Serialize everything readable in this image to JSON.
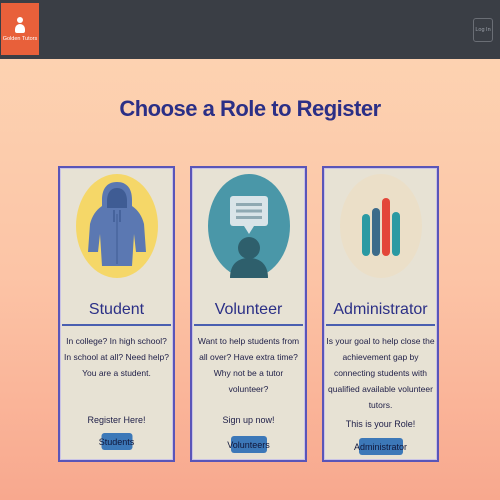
{
  "header": {
    "logo_text": "Golden Tutors",
    "login_label": "Log In"
  },
  "page_title": "Choose a Role to Register",
  "roles": [
    {
      "title": "Student",
      "description": "In college? In high school? In school at all? Need help? You are a student.",
      "cta_text": "Register Here!",
      "button_label": "Students",
      "avatar_icon": "hoodie-icon"
    },
    {
      "title": "Volunteer",
      "description": "Want to help students from all over? Have extra time? Why not be a tutor volunteer?",
      "cta_text": "Sign up now!",
      "button_label": "Volunteers",
      "avatar_icon": "person-speech-bubble-icon"
    },
    {
      "title": "Administrator",
      "description": "Is your goal to help close the achievement gap by connecting students with qualified available volunteer tutors.",
      "cta_text": "This is your Role!",
      "button_label": "Administrator",
      "avatar_icon": "bar-chart-icon"
    }
  ],
  "colors": {
    "navbar": "#3a3e45",
    "logo_bg": "#e8603a",
    "title": "#2b2f86",
    "card_bg": "#e7e2d4",
    "card_border": "#5a55b8",
    "button": "#3c78b8"
  }
}
